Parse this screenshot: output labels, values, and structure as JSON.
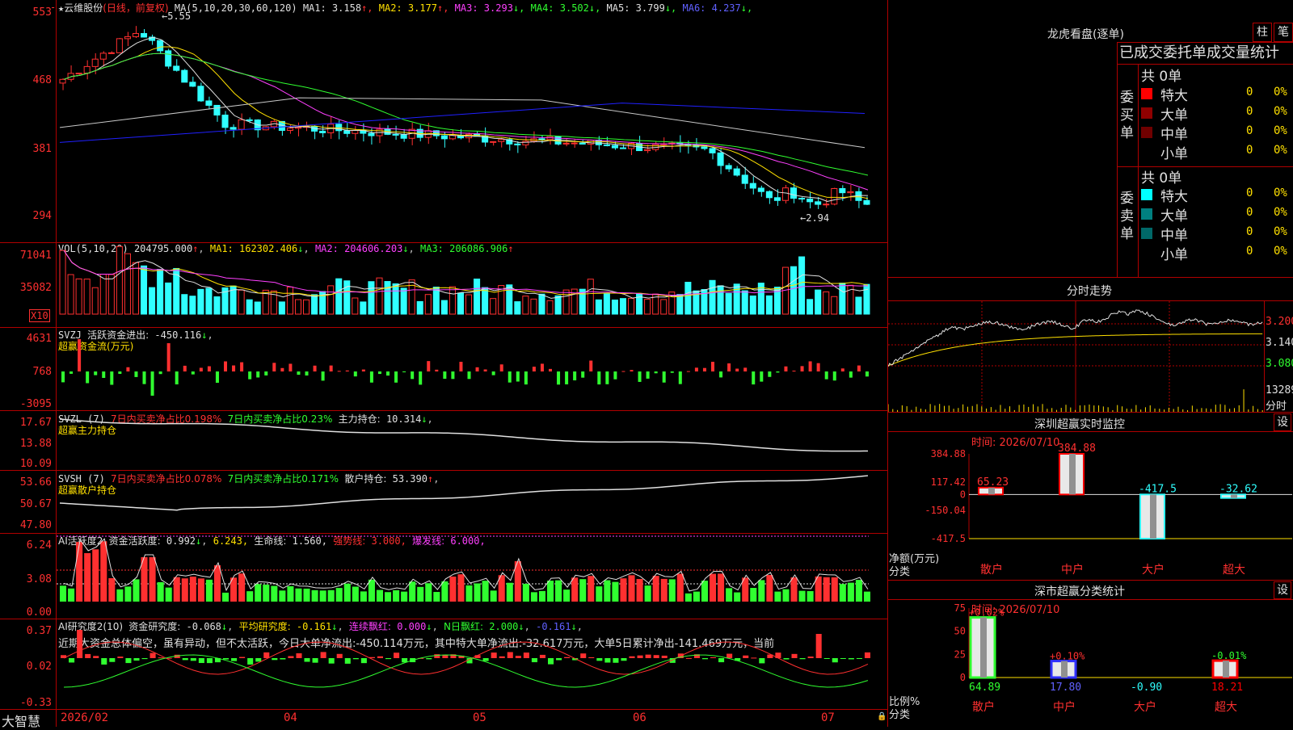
{
  "stock": {
    "name": "云维股份",
    "period": "(日线，前复权)"
  },
  "main_chart": {
    "ma_header": "MA(5,10,20,30,60,120)",
    "ma": [
      {
        "label": "MA1:",
        "value": "3.158",
        "arrow": "↑",
        "color": "#e0e0e0"
      },
      {
        "label": "MA2:",
        "value": "3.177",
        "arrow": "↑",
        "color": "#ffe000"
      },
      {
        "label": "MA3:",
        "value": "3.293",
        "arrow": "↓",
        "color": "#ff40ff"
      },
      {
        "label": "MA4:",
        "value": "3.502",
        "arrow": "↓",
        "color": "#30ff30"
      },
      {
        "label": "MA5:",
        "value": "3.799",
        "arrow": "↓",
        "color": "#e0e0e0"
      },
      {
        "label": "MA6:",
        "value": "4.237",
        "arrow": "↓",
        "color": "#6060ff"
      }
    ],
    "y_labels": [
      "553",
      "468",
      "381",
      "294"
    ],
    "high_mark": "5.55",
    "low_mark": "2.94"
  },
  "vol": {
    "header": "VOL(5,10,20)",
    "value": "204795.000",
    "ma1": "162302.406",
    "ma2": "204606.203",
    "ma3": "206086.906",
    "y_labels": [
      "71041",
      "35082"
    ],
    "unit": "X10"
  },
  "svzj": {
    "name": "SVZJ",
    "label": "活跃资金进出:",
    "value": "-450.116",
    "sub": "超赢资金流(万元)",
    "y_labels": [
      "4631",
      "768",
      "-3095"
    ]
  },
  "svzl": {
    "name": "SVZL (7)",
    "t1": "7日内买卖净占比0.198%",
    "t2": "7日内买卖净占比0.23%",
    "t3": "主力持仓:",
    "v3": "10.314",
    "sub": "超赢主力持仓",
    "y_labels": [
      "17.67",
      "13.88",
      "10.09"
    ]
  },
  "svsh": {
    "name": "SVSH (7)",
    "t1": "7日内买卖净占比0.078%",
    "t2": "7日内买卖净占比0.171%",
    "t3": "散户持仓:",
    "v3": "53.390",
    "sub": "超赢散户持仓",
    "y_labels": [
      "53.66",
      "50.67",
      "47.80"
    ]
  },
  "ai1": {
    "name": "AI活跃度2",
    "l1": "资金活跃度:",
    "v1": "0.992",
    "v2": "6.243,",
    "l3": "生命线:",
    "v3": "1.560,",
    "l4": "强势线:",
    "v4": "3.000,",
    "l5": "爆发线:",
    "v5": "6.000,",
    "y_labels": [
      "6.24",
      "3.08",
      "0.00"
    ]
  },
  "ai2": {
    "name": "AI研究度2(10)",
    "l1": "资金研究度:",
    "v1": "-0.068",
    "l2": "平均研究度:",
    "v2": "-0.161",
    "l3": "连续飘红:",
    "v3": "0.000",
    "l4": "N日飘红:",
    "v4": "2.000",
    "v5": "-0.161",
    "text": "近期大资金总体偏空，虽有异动，但不太活跃，今日大单净流出:-450.114万元，其中特大单净流出:-32.617万元，大单5日累计净出-141.469万元，当前",
    "y_labels": [
      "0.37",
      "0.02",
      "-0.33"
    ]
  },
  "x_axis": {
    "logo": "大智慧",
    "labels": [
      "2026/02",
      "04",
      "05",
      "06",
      "07"
    ]
  },
  "lhb": {
    "title": "龙虎看盘(逐单)",
    "btn1": "柱",
    "btn2": "笔",
    "header": "已成交委托单成交量统计",
    "buy": {
      "side": "委买单",
      "total": "共 0单",
      "rows": [
        {
          "name": "特大",
          "v": "0",
          "p": "0%",
          "color": "#ff0000"
        },
        {
          "name": "大单",
          "v": "0",
          "p": "0%",
          "color": "#900000"
        },
        {
          "name": "中单",
          "v": "0",
          "p": "0%",
          "color": "#700000"
        },
        {
          "name": "小单",
          "v": "0",
          "p": "0%",
          "color": "#000000"
        }
      ]
    },
    "sell": {
      "side": "委卖单",
      "total": "共 0单",
      "rows": [
        {
          "name": "特大",
          "v": "0",
          "p": "0%",
          "color": "#00ffff"
        },
        {
          "name": "大单",
          "v": "0",
          "p": "0%",
          "color": "#008080"
        },
        {
          "name": "中单",
          "v": "0",
          "p": "0%",
          "color": "#006868"
        },
        {
          "name": "小单",
          "v": "0",
          "p": "0%",
          "color": "#000000"
        }
      ]
    }
  },
  "intraday": {
    "title": "分时走势",
    "y_labels": [
      "3.200",
      "3.140",
      "3.080"
    ],
    "vol_label": "13289",
    "unit": "分时"
  },
  "monitor": {
    "title": "深圳超赢实时监控",
    "btn": "设",
    "date": "时间: 2026/07/10",
    "y_labels": [
      "384.88",
      "117.42",
      "0",
      "-150.04",
      "-417.5"
    ],
    "net": "净额(万元)",
    "cat": "分类",
    "bars": [
      {
        "name": "散户",
        "label": "65.23",
        "v": 65.23,
        "color": "#ff0000"
      },
      {
        "name": "中户",
        "label": "384.88",
        "v": 384.88,
        "color": "#ff0000"
      },
      {
        "name": "大户",
        "label": "-417.5",
        "v": -417.5,
        "color": "#30ffff"
      },
      {
        "name": "超大",
        "label": "-32.62",
        "v": -32.62,
        "color": "#30ffff"
      }
    ]
  },
  "classify": {
    "title": "深市超赢分类统计",
    "btn": "设",
    "date": "时间: 2026/07/10",
    "y_labels": [
      "75",
      "50",
      "25",
      "0"
    ],
    "ratio": "比例%",
    "cat": "分类",
    "bars": [
      {
        "name": "散户",
        "top": "+0.02%",
        "bottom": "64.89",
        "v": 64.89,
        "color": "#30ff30"
      },
      {
        "name": "中户",
        "top": "+0.10%",
        "bottom": "17.80",
        "v": 17.8,
        "color": "#3030ff"
      },
      {
        "name": "大户",
        "top": "",
        "bottom": "-0.90",
        "v": 0,
        "color": "#30ffff"
      },
      {
        "name": "超大",
        "top": "-0.01%",
        "bottom": "18.21",
        "v": 18.21,
        "color": "#ff0000"
      }
    ]
  }
}
